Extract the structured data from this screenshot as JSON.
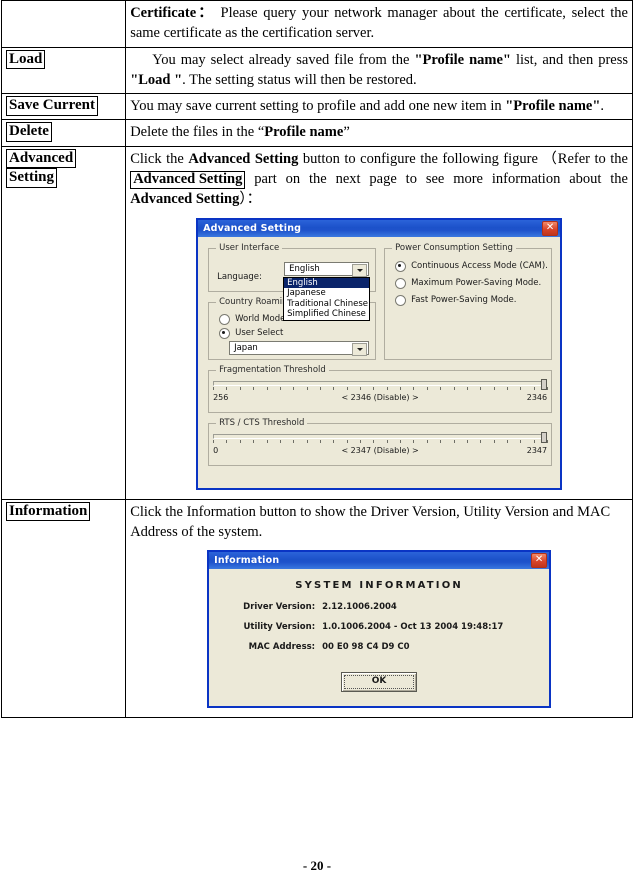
{
  "document": {
    "page_number": "- 20 -"
  },
  "table": {
    "rows": [
      {
        "label": "",
        "desc_html_parts": {
          "lead_bold": "Certificate",
          "colon": "：",
          "text": "Please query your network manager about the certificate, select the same certificate as the certification server."
        }
      },
      {
        "label": "Load",
        "line1_a": "You may select already saved file from the ",
        "line1_b": "\"Profile name\"",
        "line1_c": " list, and then press ",
        "line1_d": "\"Load \"",
        "line1_e": ". The setting status will then be restored."
      },
      {
        "label": "Save Current",
        "line1_a": "You may save current setting to profile and add one new item in ",
        "line1_b": "\"Profile name\"",
        "line1_c": "."
      },
      {
        "label": "Delete",
        "line1_a": "Delete the files in the “",
        "line1_b": "Profile name",
        "line1_c": "”"
      },
      {
        "label_line1": "Advanced",
        "label_line2": "Setting",
        "text_a": "Click the ",
        "text_b": "Advanced Setting",
        "text_c": " button to configure the following figure （Refer to the ",
        "text_d": "Advanced Setting",
        "text_e": " part on the next page to see more information about the ",
        "text_f": "Advanced Setting",
        "text_g": "）："
      },
      {
        "label": "Information",
        "text": "Click the Information button to show the Driver Version, Utility Version and MAC Address of the system."
      }
    ]
  },
  "advanced_dialog": {
    "title": "Advanced Setting",
    "close_label": "✕",
    "user_interface": {
      "group_title": "User Interface",
      "language_label": "Language:",
      "selected": "English",
      "options": [
        "English",
        "Japanese",
        "Traditional Chinese",
        "Simplified Chinese"
      ]
    },
    "country_roaming": {
      "group_title": "Country Roaming",
      "world_mode": "World Mode",
      "user_select": "User Select",
      "country_selected": "Japan"
    },
    "power_consumption": {
      "group_title": "Power Consumption Setting",
      "options": [
        "Continuous Access Mode (CAM).",
        "Maximum Power-Saving Mode.",
        "Fast Power-Saving Mode."
      ],
      "selected_index": 0
    },
    "fragmentation": {
      "group_title": "Fragmentation Threshold",
      "min": "256",
      "current": "< 2346 (Disable) >",
      "max": "2346",
      "thumb_percent": 100
    },
    "rts_cts": {
      "group_title": "RTS / CTS Threshold",
      "min": "0",
      "current": "< 2347 (Disable) >",
      "max": "2347",
      "thumb_percent": 100
    }
  },
  "information_dialog": {
    "title": "Information",
    "close_label": "✕",
    "heading": "SYSTEM INFORMATION",
    "fields": [
      {
        "key": "Driver Version:",
        "value": "2.12.1006.2004"
      },
      {
        "key": "Utility Version:",
        "value": "1.0.1006.2004 - Oct 13 2004 19:48:17"
      },
      {
        "key": "MAC Address:",
        "value": "00 E0 98 C4 D9 C0"
      }
    ],
    "ok_label": "OK"
  },
  "colors": {
    "title_bar_blue": "#1c51c9",
    "dialog_face": "#ece9d8",
    "dialog_border": "#0A34C4",
    "selection_blue": "#0A246A",
    "close_red": "#d9452a"
  }
}
